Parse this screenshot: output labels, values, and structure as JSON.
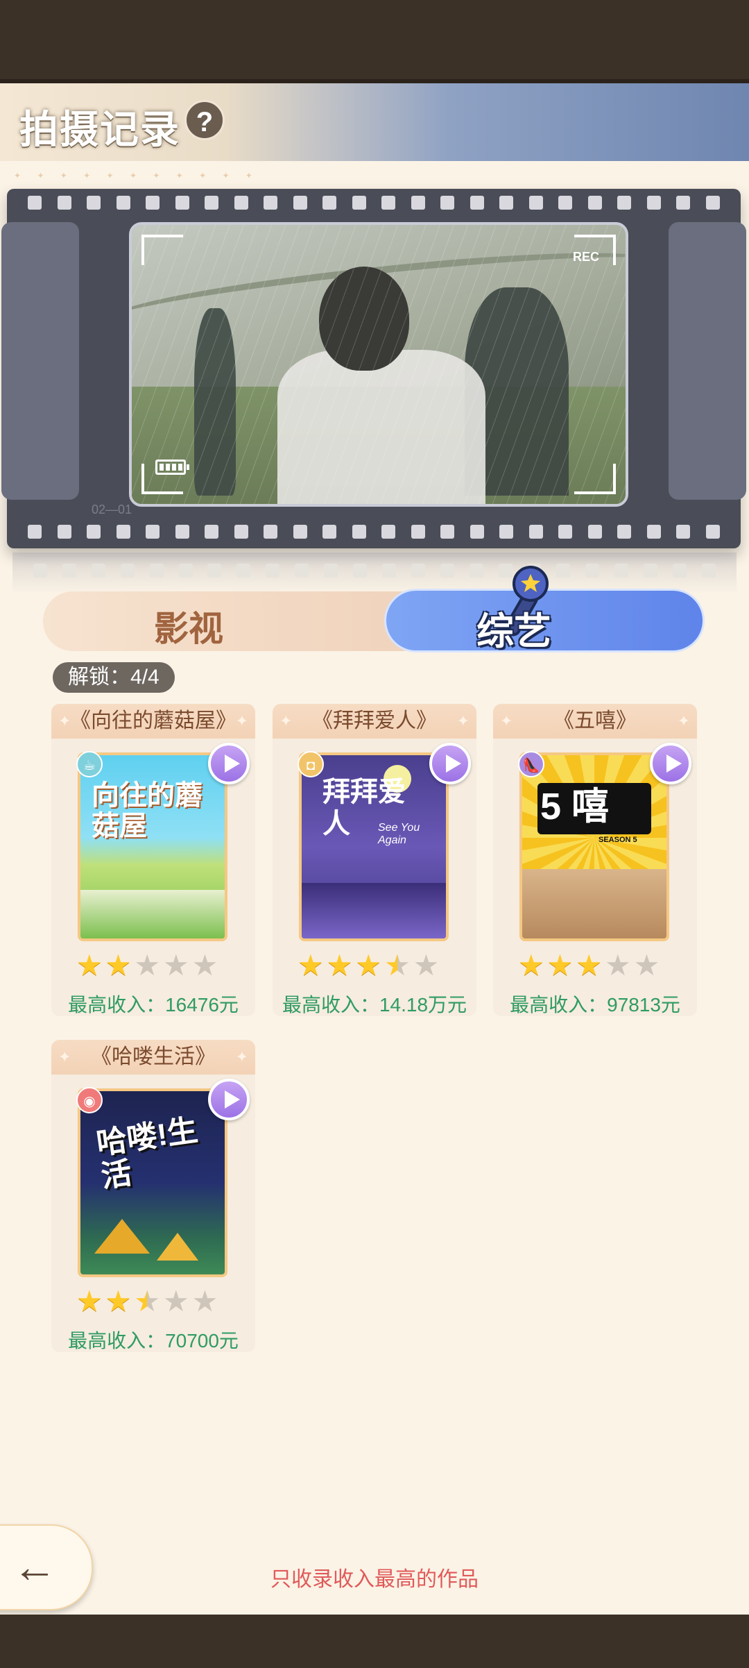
{
  "header": {
    "title": "拍摄记录",
    "help": "?"
  },
  "viewer": {
    "rec": "REC",
    "frame_label": "02—01"
  },
  "tabs": [
    {
      "label": "影视",
      "active": false
    },
    {
      "label": "综艺",
      "active": true
    }
  ],
  "unlock": "解锁：4/4",
  "cards": [
    {
      "title": "《向往的蘑菇屋》",
      "poster_text": "向往的蘑菇屋",
      "stars": 2,
      "income": "最高收入：16476元",
      "badge": "cup-icon"
    },
    {
      "title": "《拜拜爱人》",
      "poster_text": "拜拜爱人",
      "poster_sub": "See You Again",
      "stars": 3.5,
      "income": "最高收入：14.18万元",
      "badge": "bag-icon"
    },
    {
      "title": "《五嘻》",
      "poster_text": "5 嘻",
      "poster_sub": "SEASON 5",
      "stars": 3,
      "income": "最高收入：97813元",
      "badge": "shoe-icon"
    },
    {
      "title": "《哈喽生活》",
      "poster_text": "哈喽!生活",
      "stars": 2.5,
      "income": "最高收入：70700元",
      "badge": "game-icon"
    }
  ],
  "footer": {
    "note": "只收录收入最高的作品",
    "back_label": "←"
  },
  "colors": {
    "accent_blue": "#6f92ef",
    "income_green": "#2f9b63",
    "note_red": "#e05a5a",
    "star": "#ffc928"
  }
}
